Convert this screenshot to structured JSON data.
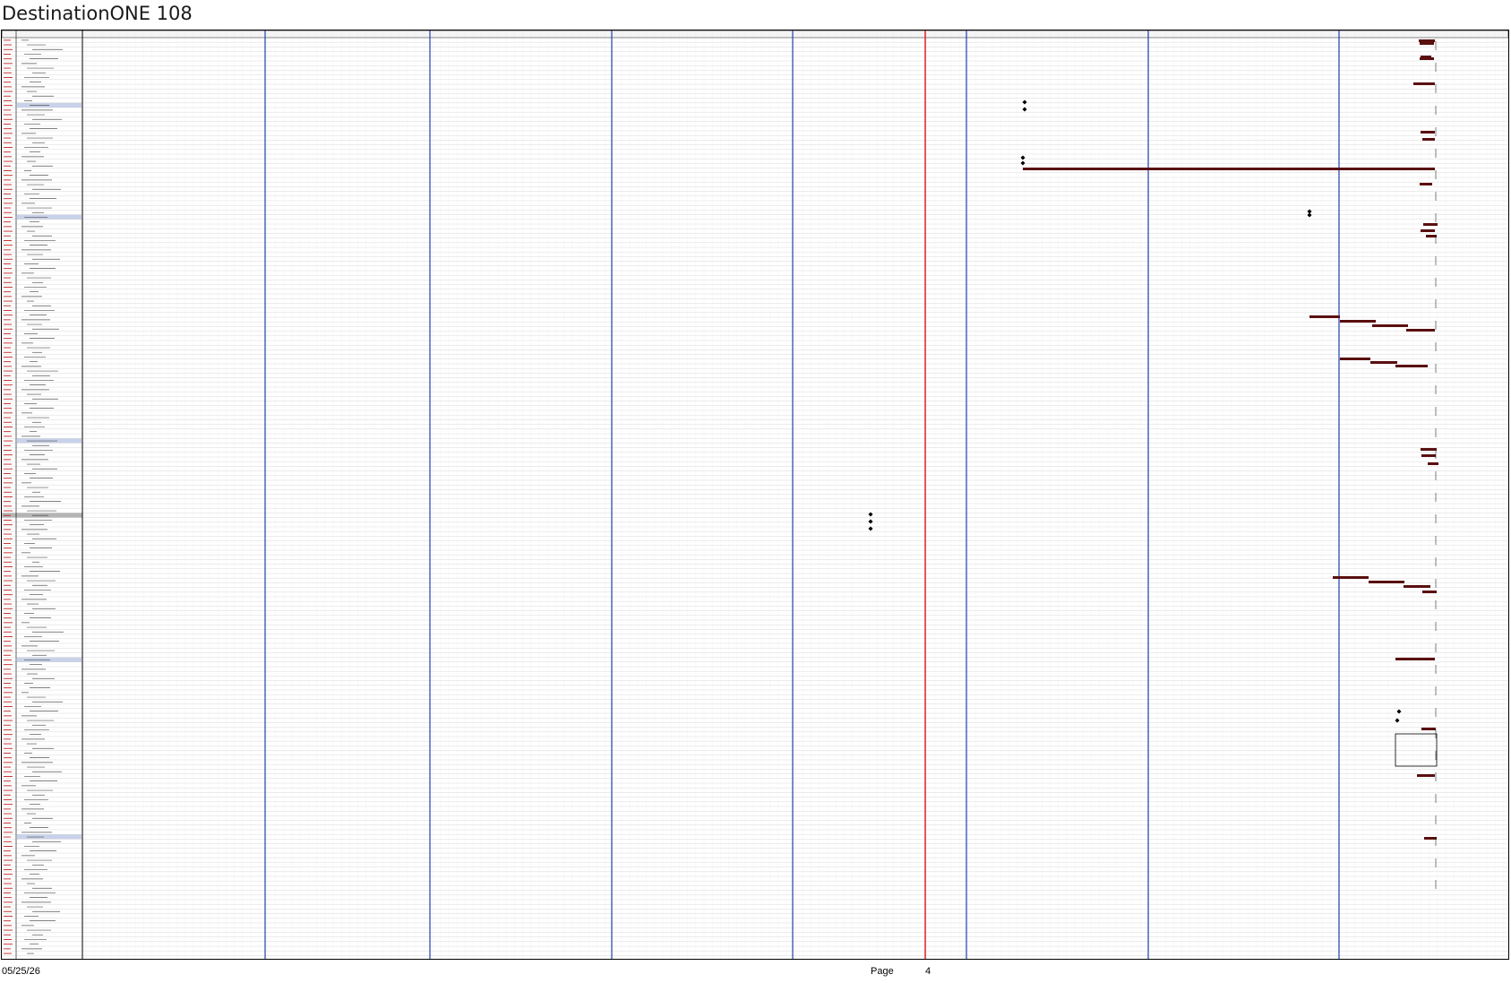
{
  "document": {
    "title": "DestinationONE 108"
  },
  "footer": {
    "date": "05/25/26",
    "page_label": "Page",
    "page_number": "4"
  },
  "colors": {
    "grid_line": "#c8c8c8",
    "week_separator": "#1f3fb0",
    "today_line": "#e02020",
    "task_bar": "#5a0f0f",
    "summary_row": "#c8d2ea",
    "highlight_row": "#b4b4b4",
    "id_text": "#c02020"
  }
}
